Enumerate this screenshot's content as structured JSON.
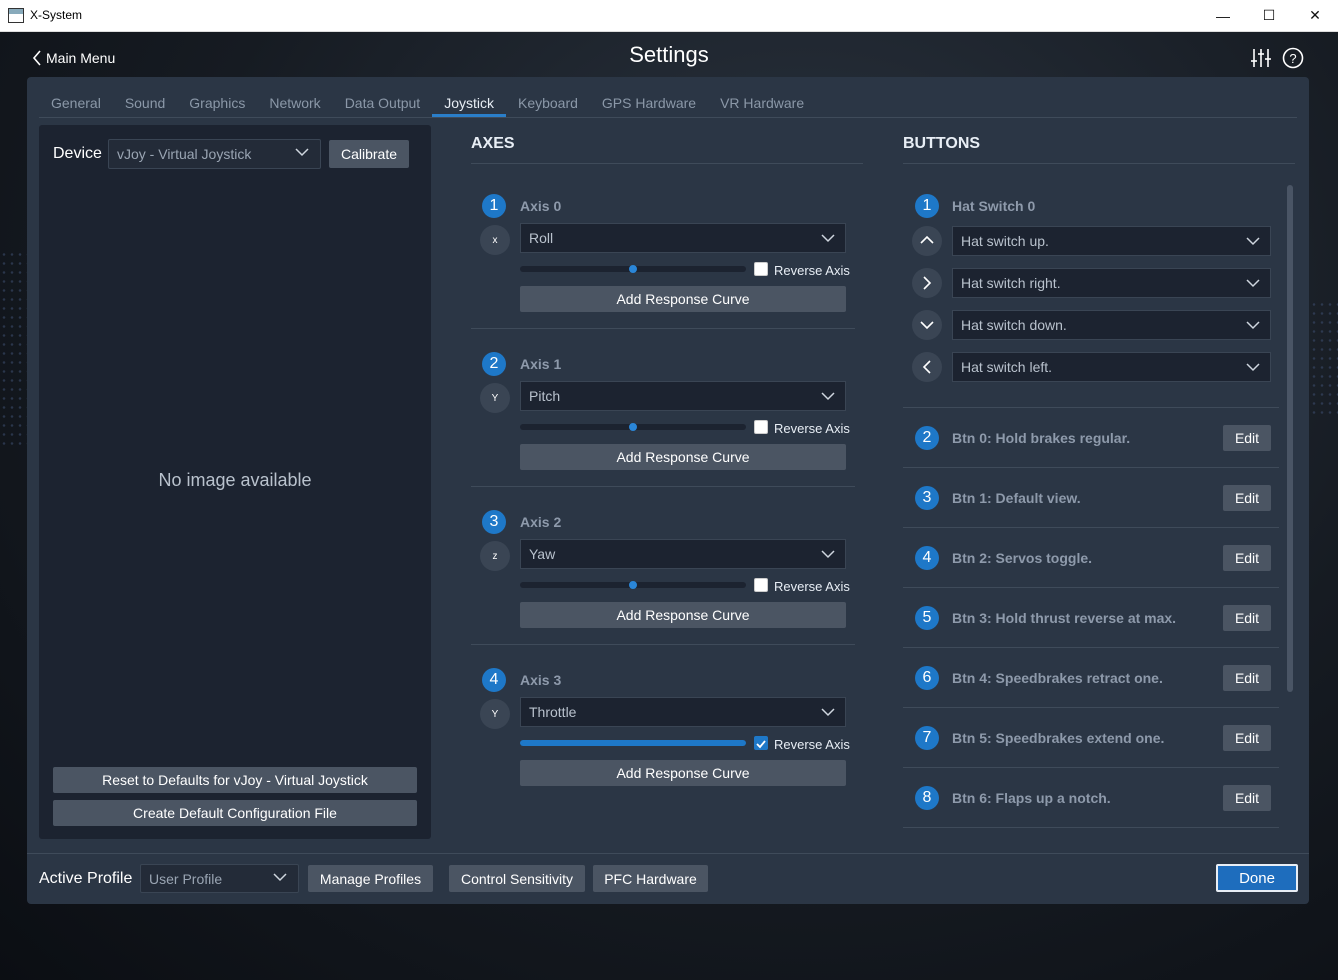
{
  "window": {
    "title": "X-System",
    "minimize": "—",
    "maximize": "☐",
    "close": "✕"
  },
  "header": {
    "back_label": "Main Menu",
    "title": "Settings"
  },
  "tabs": [
    {
      "label": "General"
    },
    {
      "label": "Sound"
    },
    {
      "label": "Graphics"
    },
    {
      "label": "Network"
    },
    {
      "label": "Data Output"
    },
    {
      "label": "Joystick"
    },
    {
      "label": "Keyboard"
    },
    {
      "label": "GPS Hardware"
    },
    {
      "label": "VR Hardware"
    }
  ],
  "active_tab": "Joystick",
  "device": {
    "label": "Device",
    "selected": "vJoy - Virtual Joystick",
    "calibrate_label": "Calibrate",
    "no_image": "No image available",
    "reset_label": "Reset to Defaults for vJoy - Virtual Joystick",
    "create_label": "Create Default Configuration File"
  },
  "axes": {
    "heading": "AXES",
    "reverse_label": "Reverse Axis",
    "curve_label": "Add Response Curve",
    "items": [
      {
        "num": "1",
        "title": "Axis 0",
        "icon_letter": "x",
        "assignment": "Roll",
        "position": 0.5,
        "reverse": false
      },
      {
        "num": "2",
        "title": "Axis 1",
        "icon_letter": "Y",
        "assignment": "Pitch",
        "position": 0.5,
        "reverse": false
      },
      {
        "num": "3",
        "title": "Axis 2",
        "icon_letter": "z",
        "assignment": "Yaw",
        "position": 0.5,
        "reverse": false
      },
      {
        "num": "4",
        "title": "Axis 3",
        "icon_letter": "Y",
        "assignment": "Throttle",
        "position": 1.0,
        "reverse": true
      }
    ]
  },
  "buttons": {
    "heading": "BUTTONS",
    "hat": {
      "num": "1",
      "title": "Hat Switch 0",
      "directions": [
        {
          "icon": "chevron-up-icon",
          "assignment": "Hat switch up."
        },
        {
          "icon": "chevron-right-icon",
          "assignment": "Hat switch right."
        },
        {
          "icon": "chevron-down-icon",
          "assignment": "Hat switch down."
        },
        {
          "icon": "chevron-left-icon",
          "assignment": "Hat switch left."
        }
      ]
    },
    "edit_label": "Edit",
    "items": [
      {
        "num": "2",
        "label": "Btn 0: Hold brakes regular."
      },
      {
        "num": "3",
        "label": "Btn 1: Default view."
      },
      {
        "num": "4",
        "label": "Btn 2: Servos toggle."
      },
      {
        "num": "5",
        "label": "Btn 3: Hold thrust reverse at max."
      },
      {
        "num": "6",
        "label": "Btn 4: Speedbrakes retract one."
      },
      {
        "num": "7",
        "label": "Btn 5: Speedbrakes extend one."
      },
      {
        "num": "8",
        "label": "Btn 6: Flaps up a notch."
      }
    ]
  },
  "footer": {
    "profile_label": "Active Profile",
    "profile_selected": "User Profile",
    "manage_label": "Manage Profiles",
    "sensitivity_label": "Control Sensitivity",
    "pfc_label": "PFC Hardware",
    "done_label": "Done"
  },
  "colors": {
    "accent": "#1e78c8",
    "panel": "#2b3645",
    "dark": "#1c2330"
  }
}
